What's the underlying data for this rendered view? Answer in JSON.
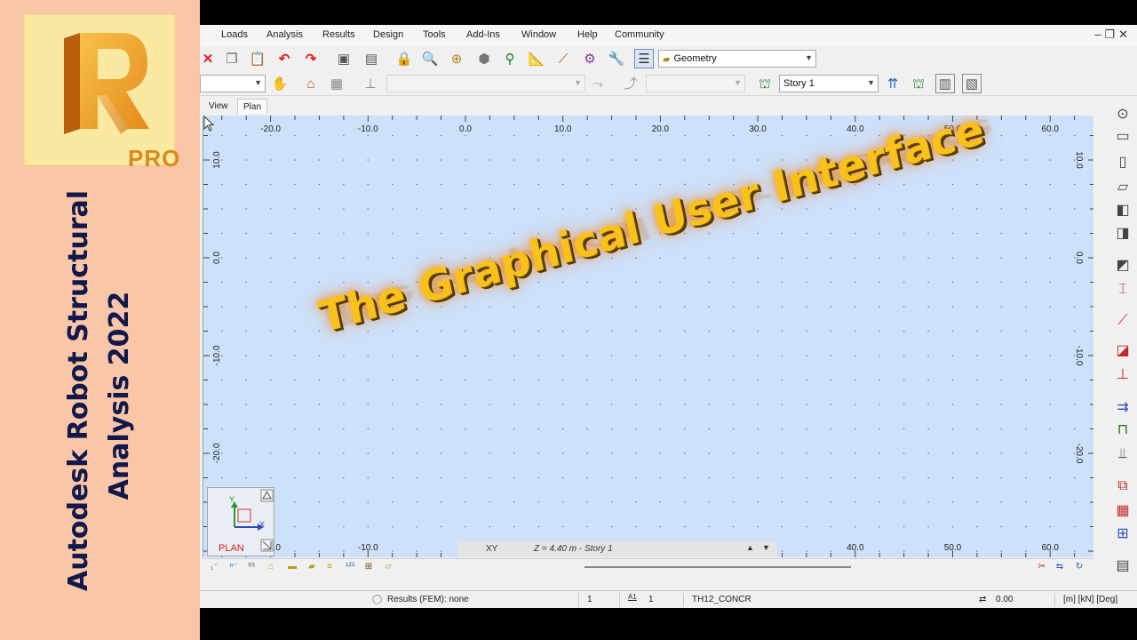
{
  "promo": {
    "logo_letter": "R",
    "logo_badge": "PRO",
    "title_line1": "Autodesk Robot Structural",
    "title_line2": "Analysis 2022"
  },
  "menu": [
    "Loads",
    "Analysis",
    "Results",
    "Design",
    "Tools",
    "Add-Ins",
    "Window",
    "Help",
    "Community"
  ],
  "toolbar": {
    "layout_combo_value": "Geometry",
    "story_combo_value": "Story 1"
  },
  "view_tabs": [
    "View",
    "Plan"
  ],
  "canvas": {
    "banner_text": "The Graphical User Interface",
    "x_ticks_top": [
      "-20.0",
      "-10.0",
      "0.0",
      "10.0",
      "20.0",
      "30.0",
      "40.0",
      "50.0",
      "60.0"
    ],
    "x_ticks_bottom": [
      "-20.0",
      "-10.0",
      "40.0",
      "50.0",
      "60.0"
    ],
    "y_ticks_left": [
      "10.0",
      "0.0",
      "-10.0",
      "-20.0"
    ],
    "y_ticks_right": [
      "10.0",
      "0.0",
      "-10.0",
      "-20.0"
    ],
    "axis_indicator": {
      "y_label": "Y",
      "x_label": "X",
      "view_label": "PLAN"
    },
    "coord_bar": {
      "plane": "XY",
      "level": "Z = 4.40 m - Story 1"
    }
  },
  "status": {
    "results": "Results (FEM): none",
    "field1": "1",
    "field2_icon": "A1",
    "field2": "1",
    "section": "TH12_CONCR",
    "angle": "0.00",
    "units": "[m] [kN] [Deg]"
  },
  "colors": {
    "promo_bg": "#f9c6a8",
    "canvas_bg": "#cde1fa",
    "banner_text": "#f8c21a",
    "title_text": "#11184a"
  }
}
